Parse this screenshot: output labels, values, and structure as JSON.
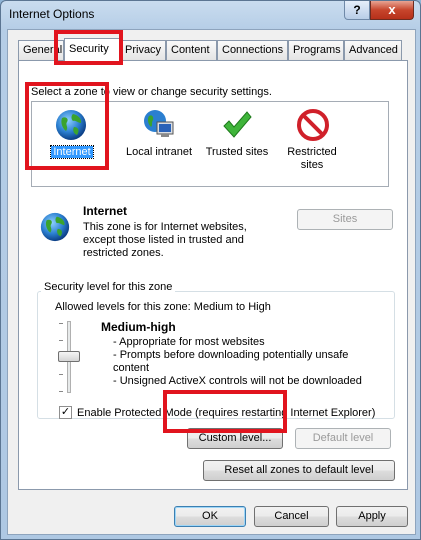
{
  "window": {
    "title": "Internet Options",
    "help_label": "?",
    "close_label": "x"
  },
  "tabs": [
    "General",
    "Security",
    "Privacy",
    "Content",
    "Connections",
    "Programs",
    "Advanced"
  ],
  "zone_prompt": "Select a zone to view or change security settings.",
  "zones": [
    {
      "label": "Internet",
      "icon": "globe-icon",
      "selected": true
    },
    {
      "label": "Local intranet",
      "icon": "intranet-icon",
      "selected": false
    },
    {
      "label": "Trusted sites",
      "icon": "checkmark-icon",
      "selected": false
    },
    {
      "label": "Restricted",
      "label2": "sites",
      "icon": "no-entry-icon",
      "selected": false
    }
  ],
  "zone_info": {
    "name": "Internet",
    "description": [
      "This zone is for Internet websites,",
      "except those listed in trusted and",
      "restricted zones."
    ],
    "sites_button": "Sites"
  },
  "security_level": {
    "group_title": "Security level for this zone",
    "allowed": "Allowed levels for this zone: Medium to High",
    "level_name": "Medium-high",
    "bullets": [
      "- Appropriate for most websites",
      "- Prompts before downloading potentially unsafe",
      "content",
      "- Unsigned ActiveX controls will not be downloaded"
    ],
    "slider_level": "Medium-high"
  },
  "protected_mode": {
    "label": "Enable Protected Mode (requires restarting Internet Explorer)",
    "checked": true
  },
  "buttons": {
    "custom": "Custom level...",
    "default_level": "Default level",
    "reset_all": "Reset all zones to default level",
    "ok": "OK",
    "cancel": "Cancel",
    "apply": "Apply"
  },
  "colors": {
    "highlight": "#e1141e",
    "selection": "#3399ff"
  }
}
